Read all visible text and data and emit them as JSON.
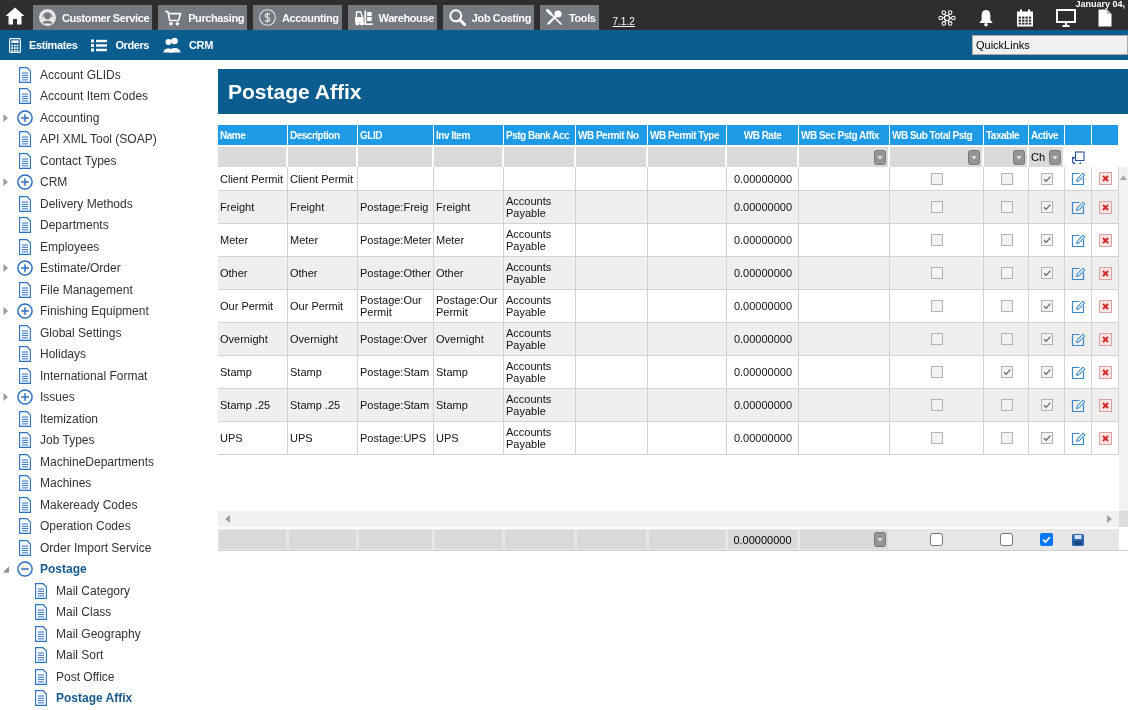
{
  "top_bar": {
    "modules": [
      "Customer Service",
      "Purchasing",
      "Accounting",
      "Warehouse",
      "Job Costing",
      "Tools"
    ],
    "version": "7.1.2",
    "date": "January 04,"
  },
  "nav_bar": {
    "items": [
      "Estimates",
      "Orders",
      "CRM"
    ],
    "quicklinks": {
      "value": "QuickLinks"
    }
  },
  "sidebar": {
    "items": [
      {
        "label": "Account GLIDs",
        "kind": "page",
        "selected": false
      },
      {
        "label": "Account Item Codes",
        "kind": "page",
        "selected": false
      },
      {
        "label": "Accounting",
        "kind": "folder",
        "expanded": false
      },
      {
        "label": "API XML Tool (SOAP)",
        "kind": "page",
        "selected": false
      },
      {
        "label": "Contact Types",
        "kind": "page",
        "selected": false
      },
      {
        "label": "CRM",
        "kind": "folder",
        "expanded": false
      },
      {
        "label": "Delivery Methods",
        "kind": "page",
        "selected": false
      },
      {
        "label": "Departments",
        "kind": "page",
        "selected": false
      },
      {
        "label": "Employees",
        "kind": "page",
        "selected": false
      },
      {
        "label": "Estimate/Order",
        "kind": "folder",
        "expanded": false
      },
      {
        "label": "File Management",
        "kind": "page",
        "selected": false
      },
      {
        "label": "Finishing Equipment",
        "kind": "folder",
        "expanded": false
      },
      {
        "label": "Global Settings",
        "kind": "page",
        "selected": false
      },
      {
        "label": "Holidays",
        "kind": "page",
        "selected": false
      },
      {
        "label": "International Format",
        "kind": "page",
        "selected": false
      },
      {
        "label": "Issues",
        "kind": "folder",
        "expanded": false
      },
      {
        "label": "Itemization",
        "kind": "page",
        "selected": false
      },
      {
        "label": "Job Types",
        "kind": "page",
        "selected": false
      },
      {
        "label": "MachineDepartments",
        "kind": "page",
        "selected": false
      },
      {
        "label": "Machines",
        "kind": "page",
        "selected": false
      },
      {
        "label": "Makeready Codes",
        "kind": "page",
        "selected": false
      },
      {
        "label": "Operation Codes",
        "kind": "page",
        "selected": false
      },
      {
        "label": "Order Import Service",
        "kind": "page",
        "selected": false
      },
      {
        "label": "Postage",
        "kind": "folder",
        "expanded": true,
        "children": [
          {
            "label": "Mail Category",
            "kind": "page",
            "selected": false
          },
          {
            "label": "Mail Class",
            "kind": "page",
            "selected": false
          },
          {
            "label": "Mail Geography",
            "kind": "page",
            "selected": false
          },
          {
            "label": "Mail Sort",
            "kind": "page",
            "selected": false
          },
          {
            "label": "Post Office",
            "kind": "page",
            "selected": false
          },
          {
            "label": "Postage Affix",
            "kind": "page",
            "selected": true
          }
        ]
      }
    ]
  },
  "page_title": "Postage Affix",
  "table": {
    "columns": [
      {
        "label": "Name",
        "kind": "text",
        "filter": {
          "kind": "text"
        }
      },
      {
        "label": "Description",
        "kind": "text",
        "filter": {
          "kind": "text"
        }
      },
      {
        "label": "GLID",
        "kind": "text",
        "filter": {
          "kind": "text"
        }
      },
      {
        "label": "Inv Item",
        "kind": "text",
        "filter": {
          "kind": "text"
        }
      },
      {
        "label": "Pstg Bank Acc",
        "kind": "text",
        "filter": {
          "kind": "text"
        }
      },
      {
        "label": "WB Permit No",
        "kind": "text",
        "filter": {
          "kind": "text"
        }
      },
      {
        "label": "WB Permit Type",
        "kind": "text",
        "filter": {
          "kind": "text"
        }
      },
      {
        "label": "WB Rate",
        "kind": "number",
        "filter": {
          "kind": "text"
        }
      },
      {
        "label": "WB Sec Pstg Affix",
        "kind": "text",
        "filter": {
          "kind": "select"
        }
      },
      {
        "label": "WB Sub Total Pstg",
        "kind": "check",
        "filter": {
          "kind": "select"
        }
      },
      {
        "label": "Taxable",
        "kind": "check",
        "filter": {
          "kind": "select"
        }
      },
      {
        "label": "Active",
        "kind": "check",
        "filter": {
          "kind": "select",
          "value": "Ch"
        }
      },
      {
        "kind": "edit",
        "filter": {
          "kind": "reset"
        }
      },
      {
        "kind": "delete"
      }
    ],
    "rows": [
      {
        "name": "Client Permit",
        "description": "Client Permit",
        "wb_rate": "0.00000000",
        "wb_sub_total_pstg": false,
        "taxable": false,
        "active": true
      },
      {
        "name": "Freight",
        "description": "Freight",
        "glid": "Postage:Freig",
        "inv_item": "Freight",
        "pstg_bank_acc": "Accounts Payable",
        "wb_rate": "0.00000000",
        "wb_sub_total_pstg": false,
        "taxable": false,
        "active": true
      },
      {
        "name": "Meter",
        "description": "Meter",
        "glid": "Postage:Meter",
        "inv_item": "Meter",
        "pstg_bank_acc": "Accounts Payable",
        "wb_rate": "0.00000000",
        "wb_sub_total_pstg": false,
        "taxable": false,
        "active": true
      },
      {
        "name": "Other",
        "description": "Other",
        "glid": "Postage:Other",
        "inv_item": "Other",
        "pstg_bank_acc": "Accounts Payable",
        "wb_rate": "0.00000000",
        "wb_sub_total_pstg": false,
        "taxable": false,
        "active": true
      },
      {
        "name": "Our Permit",
        "description": "Our Permit",
        "glid": "Postage:Our Permit",
        "inv_item": "Postage:Our Permit",
        "pstg_bank_acc": "Accounts Payable",
        "wb_rate": "0.00000000",
        "wb_sub_total_pstg": false,
        "taxable": false,
        "active": true
      },
      {
        "name": "Overnight",
        "description": "Overnight",
        "glid": "Postage:Over",
        "inv_item": "Overnight",
        "pstg_bank_acc": "Accounts Payable",
        "wb_rate": "0.00000000",
        "wb_sub_total_pstg": false,
        "taxable": false,
        "active": true
      },
      {
        "name": "Stamp",
        "description": "Stamp",
        "glid": "Postage:Stam",
        "inv_item": "Stamp",
        "pstg_bank_acc": "Accounts Payable",
        "wb_rate": "0.00000000",
        "wb_sub_total_pstg": false,
        "taxable": true,
        "active": true
      },
      {
        "name": "Stamp .25",
        "description": "Stamp .25",
        "glid": "Postage:Stam",
        "inv_item": "Stamp",
        "pstg_bank_acc": "Accounts Payable",
        "wb_rate": "0.00000000",
        "wb_sub_total_pstg": false,
        "taxable": false,
        "active": true
      },
      {
        "name": "UPS",
        "description": "UPS",
        "glid": "Postage:UPS",
        "inv_item": "UPS",
        "pstg_bank_acc": "Accounts Payable",
        "wb_rate": "0.00000000",
        "wb_sub_total_pstg": false,
        "taxable": false,
        "active": true
      }
    ],
    "footer": {
      "wb_rate": "0.00000000",
      "wb_sub_total_pstg": false,
      "taxable": false,
      "active": true
    }
  }
}
